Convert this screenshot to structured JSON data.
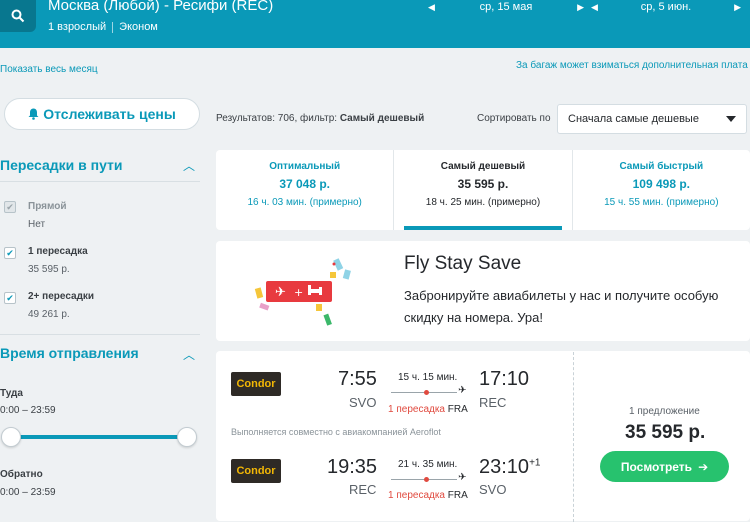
{
  "search": {
    "route": "Москва (Любой) - Ресифи (REC)",
    "passengers": "1 взрослый",
    "cabin": "Эконом",
    "depart_date": "ср, 15 мая",
    "return_date": "ср, 5 июн."
  },
  "links": {
    "show_month": "Показать весь месяц",
    "baggage_note": "За багаж может взиматься дополнительная плата"
  },
  "sidebar": {
    "track_label": "Отслеживать цены",
    "stops": {
      "title": "Пересадки в пути",
      "options": [
        {
          "label": "Прямой",
          "sub": "Нет",
          "checked": true,
          "disabled": true
        },
        {
          "label": "1 пересадка",
          "sub": "35 595 р.",
          "checked": true,
          "disabled": false
        },
        {
          "label": "2+ пересадки",
          "sub": "49 261 р.",
          "checked": true,
          "disabled": false
        }
      ]
    },
    "departure": {
      "title": "Время отправления",
      "outbound_label": "Туда",
      "outbound_range": "0:00 – 23:59",
      "return_label": "Обратно",
      "return_range": "0:00 – 23:59"
    }
  },
  "results": {
    "count_text": "Результатов: 706, фильтр: ",
    "filter": "Самый дешевый",
    "sort_label": "Сортировать по",
    "sort_value": "Сначала самые дешевые"
  },
  "tabs": [
    {
      "title": "Оптимальный",
      "price": "37 048 р.",
      "duration": "16 ч. 03 мин. (примерно)",
      "active": false
    },
    {
      "title": "Самый дешевый",
      "price": "35 595 р.",
      "duration": "18 ч. 25 мин. (примерно)",
      "active": true
    },
    {
      "title": "Самый быстрый",
      "price": "109 498 р.",
      "duration": "15 ч. 55 мин. (примерно)",
      "active": false
    }
  ],
  "promo": {
    "title": "Fly Stay Save",
    "text": "Забронируйте авиабилеты у нас и получите особую скидку на номера. Ура!"
  },
  "ticket": {
    "airline": "Condor",
    "outbound": {
      "dep_time": "7:55",
      "dep_airport": "SVO",
      "duration": "15 ч. 15 мин.",
      "stops": "1 пересадка",
      "via": "FRA",
      "arr_time": "17:10",
      "arr_airport": "REC"
    },
    "codeshare": "Выполняется совместно с авиакомпанией Aeroflot",
    "inbound": {
      "dep_time": "19:35",
      "dep_airport": "REC",
      "duration": "21 ч. 35 мин.",
      "stops": "1 пересадка",
      "via": "FRA",
      "arr_time": "23:10",
      "day_offset": "+1",
      "arr_airport": "SVO"
    },
    "offers": "1 предложение",
    "price": "35 595 р.",
    "view_label": "Посмотреть"
  },
  "colors": {
    "brand": "#0a99b8",
    "cta": "#27c26e",
    "stop": "#e04a3f"
  }
}
